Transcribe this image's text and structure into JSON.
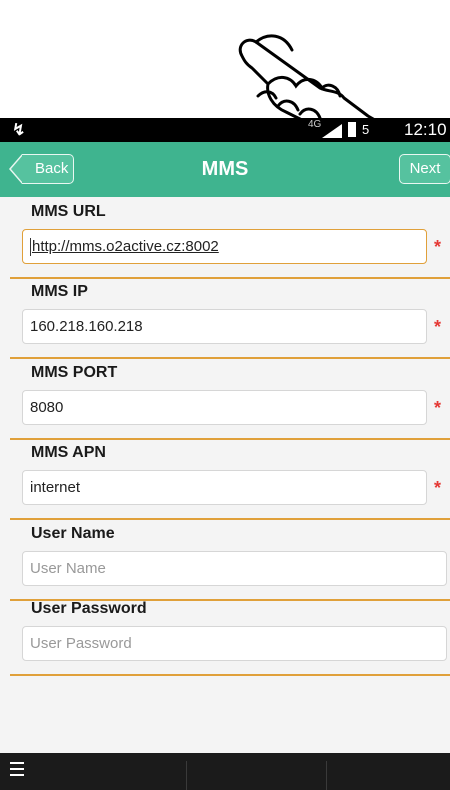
{
  "status_bar": {
    "network": "4G",
    "battery": "5",
    "time": "12:10"
  },
  "app_bar": {
    "back_label": "Back",
    "title": "MMS",
    "next_label": "Next"
  },
  "fields": [
    {
      "label": "MMS URL",
      "value": "http://mms.o2active.cz:8002",
      "placeholder": "",
      "required_mark": "*"
    },
    {
      "label": "MMS IP",
      "value": "160.218.160.218",
      "placeholder": "",
      "required_mark": "*"
    },
    {
      "label": "MMS PORT",
      "value": "8080",
      "placeholder": "",
      "required_mark": "*"
    },
    {
      "label": "MMS APN",
      "value": "internet",
      "placeholder": "",
      "required_mark": "*"
    },
    {
      "label": "User Name",
      "value": "",
      "placeholder": "User Name"
    },
    {
      "label": "User Password",
      "value": "",
      "placeholder": "User Password"
    }
  ],
  "colors": {
    "accent": "#3fb48f",
    "divider": "#e0a03a",
    "required": "#e53935"
  },
  "icons": {
    "pointer": "pointing-hand-icon",
    "menu": "menu-icon"
  }
}
